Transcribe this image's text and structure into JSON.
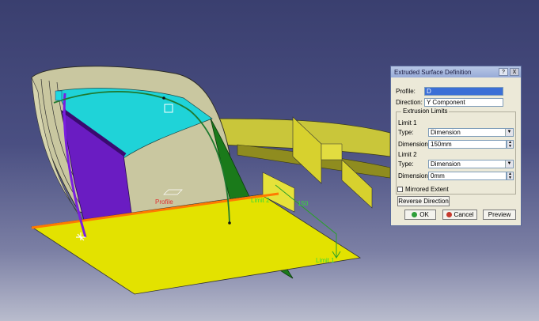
{
  "viewport": {
    "labels": {
      "profile": "Profile",
      "limit2": "Limit 2",
      "dimension": "150",
      "limit1": "Limit 1"
    }
  },
  "dialog": {
    "title": "Extruded Surface Definition",
    "help_label": "?",
    "close_label": "X",
    "profile_label": "Profile:",
    "profile_value": "D",
    "direction_label": "Direction:",
    "direction_value": "Y Component",
    "limits_legend": "Extrusion Limits",
    "limit1": {
      "title": "Limit 1",
      "type_label": "Type:",
      "type_value": "Dimension",
      "dimension_label": "Dimension:",
      "dimension_value": "150mm"
    },
    "limit2": {
      "title": "Limit 2",
      "type_label": "Type:",
      "type_value": "Dimension",
      "dimension_label": "Dimension:",
      "dimension_value": "0mm"
    },
    "mirrored_label": "Mirrored Extent",
    "mirrored_checked": false,
    "reverse_label": "Reverse Direction",
    "ok_label": "OK",
    "cancel_label": "Cancel",
    "preview_label": "Preview",
    "ok_color": "#2e9e3a",
    "cancel_color": "#c63a2e"
  }
}
